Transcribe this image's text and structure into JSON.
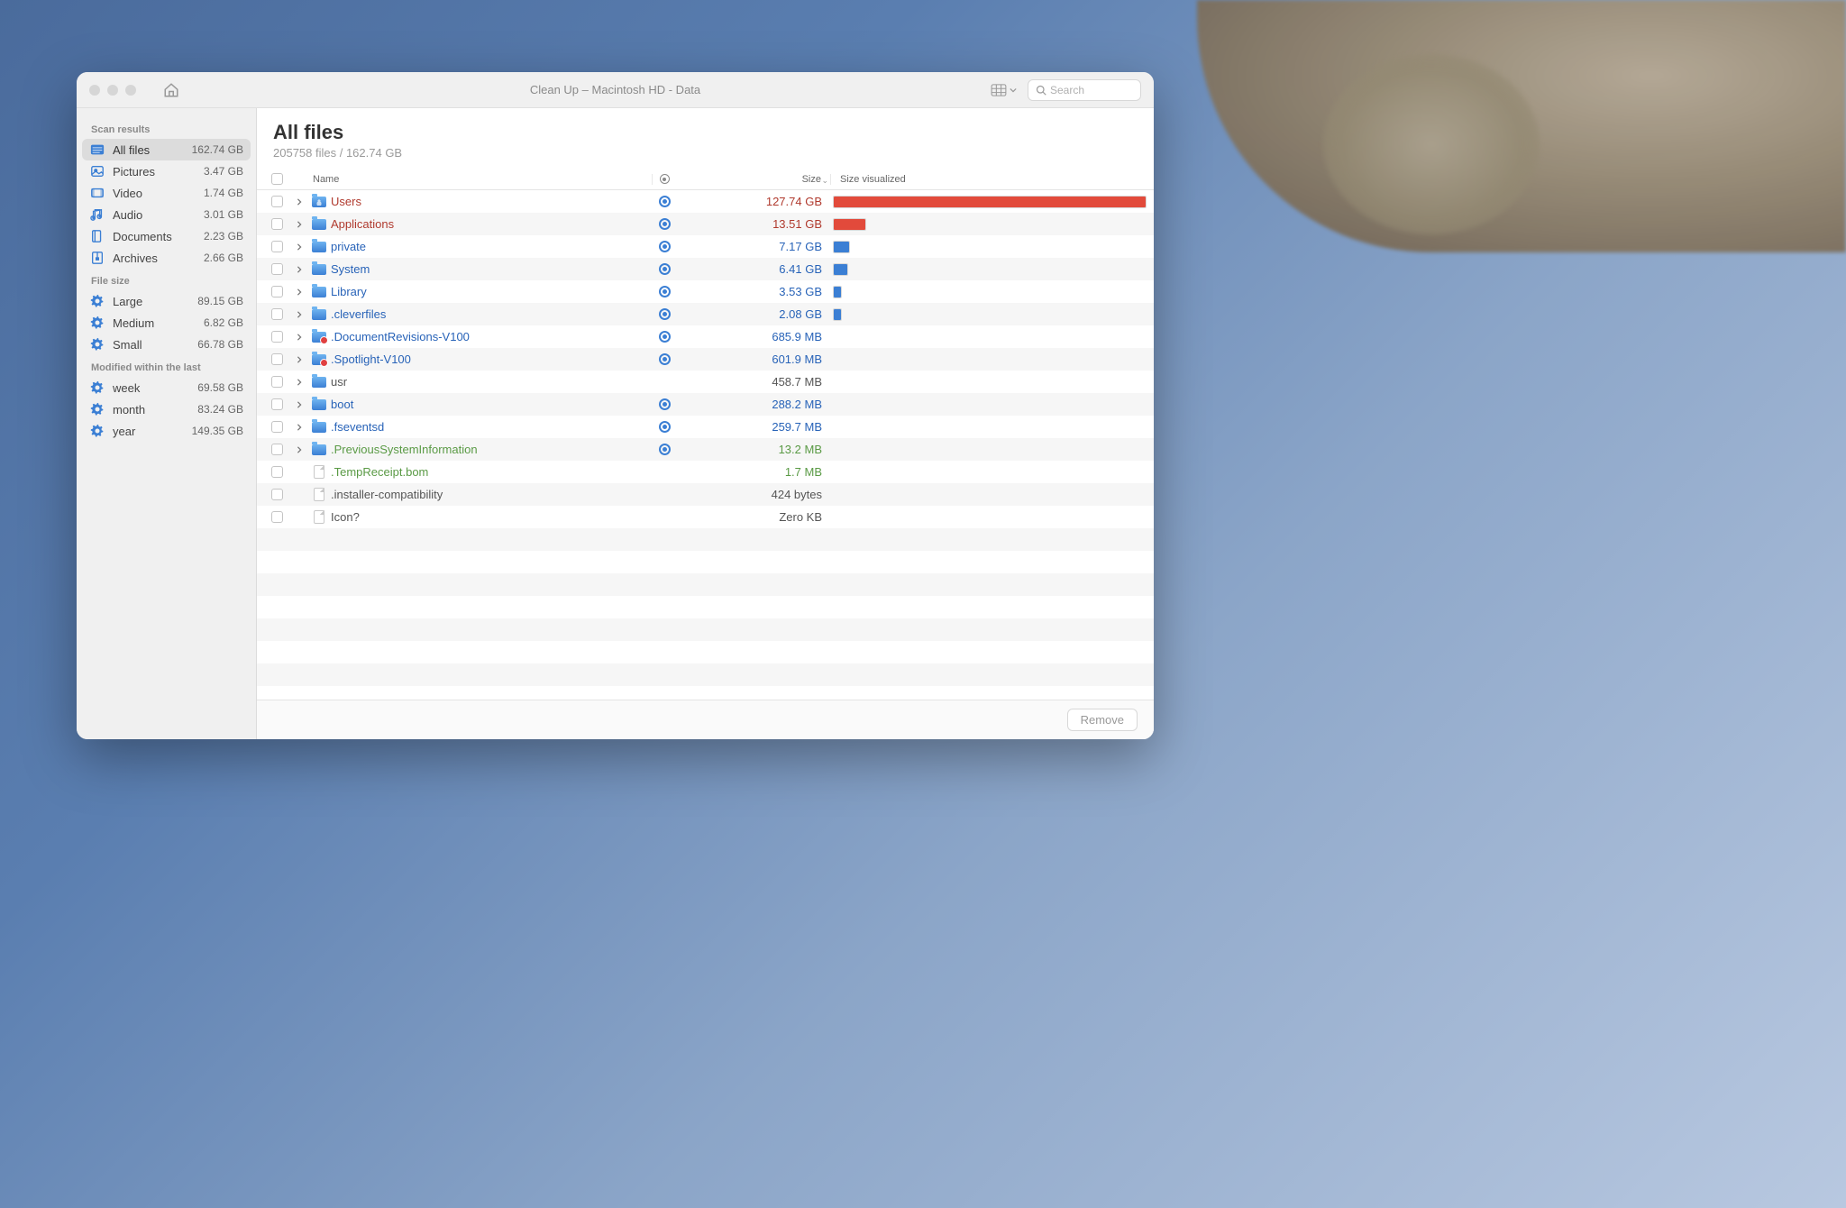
{
  "window": {
    "title": "Clean Up – Macintosh HD - Data",
    "search_placeholder": "Search"
  },
  "sidebar": {
    "sections": [
      {
        "header": "Scan results",
        "items": [
          {
            "icon": "allfiles",
            "label": "All files",
            "size": "162.74 GB",
            "active": true
          },
          {
            "icon": "pictures",
            "label": "Pictures",
            "size": "3.47 GB"
          },
          {
            "icon": "video",
            "label": "Video",
            "size": "1.74 GB"
          },
          {
            "icon": "audio",
            "label": "Audio",
            "size": "3.01 GB"
          },
          {
            "icon": "documents",
            "label": "Documents",
            "size": "2.23 GB"
          },
          {
            "icon": "archives",
            "label": "Archives",
            "size": "2.66 GB"
          }
        ]
      },
      {
        "header": "File size",
        "items": [
          {
            "icon": "gear",
            "label": "Large",
            "size": "89.15 GB"
          },
          {
            "icon": "gear",
            "label": "Medium",
            "size": "6.82 GB"
          },
          {
            "icon": "gear",
            "label": "Small",
            "size": "66.78 GB"
          }
        ]
      },
      {
        "header": "Modified within the last",
        "items": [
          {
            "icon": "gear",
            "label": "week",
            "size": "69.58 GB"
          },
          {
            "icon": "gear",
            "label": "month",
            "size": "83.24 GB"
          },
          {
            "icon": "gear",
            "label": "year",
            "size": "149.35 GB"
          }
        ]
      }
    ]
  },
  "main": {
    "title": "All files",
    "subtitle": "205758 files / 162.74 GB",
    "columns": {
      "name": "Name",
      "size": "Size",
      "viz": "Size visualized"
    },
    "remove_label": "Remove",
    "rows": [
      {
        "expand": true,
        "icon": "folder-users",
        "name": "Users",
        "nameClass": "name-users",
        "scan": true,
        "size": "127.74 GB",
        "sizeClass": "size-red",
        "bar": 100,
        "barColor": "#e24a3b"
      },
      {
        "expand": true,
        "icon": "folder",
        "name": "Applications",
        "nameClass": "name-apps",
        "scan": true,
        "size": "13.51 GB",
        "sizeClass": "size-red",
        "bar": 10.6,
        "barColor": "#e24a3b"
      },
      {
        "expand": true,
        "icon": "folder",
        "name": "private",
        "nameClass": "name-folder",
        "scan": true,
        "size": "7.17 GB",
        "sizeClass": "size-blue",
        "bar": 5.6,
        "barColor": "#3b7fd4"
      },
      {
        "expand": true,
        "icon": "folder",
        "name": "System",
        "nameClass": "name-folder",
        "scan": true,
        "size": "6.41 GB",
        "sizeClass": "size-blue",
        "bar": 5.0,
        "barColor": "#3b7fd4"
      },
      {
        "expand": true,
        "icon": "folder",
        "name": "Library",
        "nameClass": "name-folder",
        "scan": true,
        "size": "3.53 GB",
        "sizeClass": "size-blue",
        "bar": 2.8,
        "barColor": "#3b7fd4"
      },
      {
        "expand": true,
        "icon": "folder",
        "name": ".cleverfiles",
        "nameClass": "name-hidden",
        "scan": true,
        "size": "2.08 GB",
        "sizeClass": "size-blue",
        "bar": 1.6,
        "barColor": "#3b7fd4"
      },
      {
        "expand": true,
        "icon": "folder-red",
        "name": ".DocumentRevisions-V100",
        "nameClass": "name-hidden",
        "scan": true,
        "size": "685.9 MB",
        "sizeClass": "size-blue",
        "bar": 0
      },
      {
        "expand": true,
        "icon": "folder-red",
        "name": ".Spotlight-V100",
        "nameClass": "name-hidden",
        "scan": true,
        "size": "601.9 MB",
        "sizeClass": "size-blue",
        "bar": 0
      },
      {
        "expand": true,
        "icon": "folder",
        "name": "usr",
        "nameClass": "name-plain",
        "scan": false,
        "size": "458.7 MB",
        "sizeClass": "size-plain",
        "bar": 0
      },
      {
        "expand": true,
        "icon": "folder",
        "name": "boot",
        "nameClass": "name-folder",
        "scan": true,
        "size": "288.2 MB",
        "sizeClass": "size-blue",
        "bar": 0
      },
      {
        "expand": true,
        "icon": "folder",
        "name": ".fseventsd",
        "nameClass": "name-hidden",
        "scan": true,
        "size": "259.7 MB",
        "sizeClass": "size-blue",
        "bar": 0
      },
      {
        "expand": true,
        "icon": "folder",
        "name": ".PreviousSystemInformation",
        "nameClass": "name-green",
        "scan": true,
        "size": "13.2 MB",
        "sizeClass": "size-green",
        "bar": 0
      },
      {
        "expand": false,
        "icon": "file",
        "name": ".TempReceipt.bom",
        "nameClass": "name-green",
        "scan": false,
        "size": "1.7 MB",
        "sizeClass": "size-green",
        "bar": 0
      },
      {
        "expand": false,
        "icon": "file",
        "name": ".installer-compatibility",
        "nameClass": "name-plain",
        "scan": false,
        "size": "424 bytes",
        "sizeClass": "size-plain",
        "bar": 0
      },
      {
        "expand": false,
        "icon": "file",
        "name": "Icon?",
        "nameClass": "name-plain",
        "scan": false,
        "size": "Zero KB",
        "sizeClass": "size-plain",
        "bar": 0
      }
    ],
    "empty_rows": 7
  }
}
